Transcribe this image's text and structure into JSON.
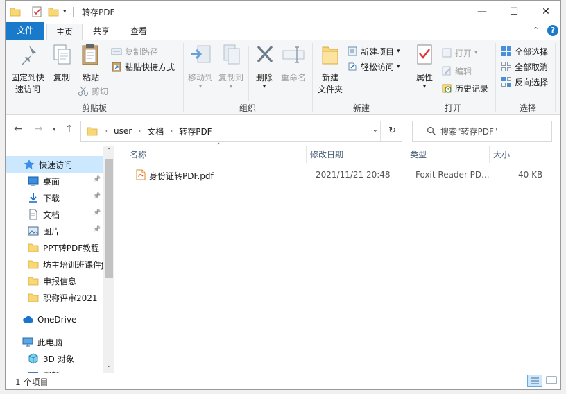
{
  "window": {
    "title": "转存PDF",
    "controls": {
      "minimize": "—",
      "maximize": "☐",
      "close": "✕"
    }
  },
  "ribbon_tabs": [
    "文件",
    "主页",
    "共享",
    "查看"
  ],
  "ribbon": {
    "clipboard": {
      "label": "剪贴板",
      "pin_quick_access": [
        "固定到快",
        "速访问"
      ],
      "copy": "复制",
      "paste": "粘贴",
      "copy_path": "复制路径",
      "paste_shortcut": "粘贴快捷方式",
      "cut": "剪切"
    },
    "organize": {
      "label": "组织",
      "move_to": "移动到",
      "copy_to": "复制到",
      "delete": "删除",
      "rename": "重命名"
    },
    "new": {
      "label": "新建",
      "new_folder": [
        "新建",
        "文件夹"
      ],
      "new_item": "新建项目",
      "easy_access": "轻松访问"
    },
    "open": {
      "label": "打开",
      "properties": "属性",
      "open": "打开",
      "edit": "编辑",
      "history": "历史记录"
    },
    "select": {
      "label": "选择",
      "select_all": "全部选择",
      "select_none": "全部取消",
      "invert": "反向选择"
    }
  },
  "address": {
    "crumbs": [
      "user",
      "文档",
      "转存PDF"
    ],
    "search_placeholder": "搜索\"转存PDF\""
  },
  "nav": {
    "quick_access": "快速访问",
    "items": [
      {
        "label": "桌面",
        "icon": "desktop-icon",
        "pinned": true
      },
      {
        "label": "下载",
        "icon": "download-icon",
        "pinned": true
      },
      {
        "label": "文档",
        "icon": "documents-icon",
        "pinned": true
      },
      {
        "label": "图片",
        "icon": "pictures-icon",
        "pinned": true
      },
      {
        "label": "PPT转PDF教程",
        "icon": "folder-icon",
        "pinned": false
      },
      {
        "label": "坊主培训班课件ƒ",
        "icon": "folder-icon",
        "pinned": false
      },
      {
        "label": "申报信息",
        "icon": "folder-icon",
        "pinned": false
      },
      {
        "label": "职称评审2021",
        "icon": "folder-icon",
        "pinned": false
      }
    ],
    "onedrive": "OneDrive",
    "this_pc": "此电脑",
    "objects_3d": "3D 对象",
    "next_partial": "视频"
  },
  "columns": {
    "name": "名称",
    "date": "修改日期",
    "type": "类型",
    "size": "大小"
  },
  "files": [
    {
      "name": "身份证转PDF.pdf",
      "date": "2021/11/21 20:48",
      "type": "Foxit Reader PD...",
      "size": "40 KB"
    }
  ],
  "status": {
    "count": "1 个项目"
  },
  "colors": {
    "accent": "#1979ca",
    "selection": "#cce8ff",
    "folder": "#f8d775"
  }
}
